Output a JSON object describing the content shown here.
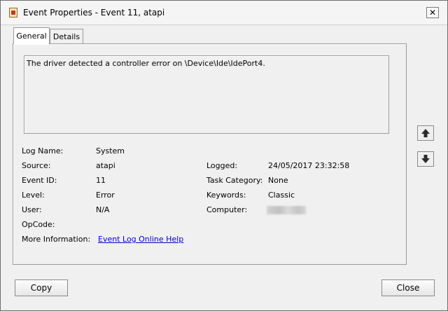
{
  "window": {
    "title": "Event Properties - Event 11, atapi",
    "close_glyph": "✕"
  },
  "tabs": [
    {
      "label": "General",
      "active": true
    },
    {
      "label": "Details",
      "active": false
    }
  ],
  "description": "The driver detected a controller error on \\Device\\Ide\\IdePort4.",
  "fields": {
    "log_name": {
      "label": "Log Name:",
      "value": "System"
    },
    "source": {
      "label": "Source:",
      "value": "atapi"
    },
    "event_id": {
      "label": "Event ID:",
      "value": "11"
    },
    "level": {
      "label": "Level:",
      "value": "Error"
    },
    "user": {
      "label": "User:",
      "value": "N/A"
    },
    "opcode": {
      "label": "OpCode:",
      "value": ""
    },
    "more_info": {
      "label": "More Information:",
      "value": "Event Log Online Help"
    },
    "logged": {
      "label": "Logged:",
      "value": "24/05/2017 23:32:58"
    },
    "task_category": {
      "label": "Task Category:",
      "value": "None"
    },
    "keywords": {
      "label": "Keywords:",
      "value": "Classic"
    },
    "computer": {
      "label": "Computer:",
      "value": ""
    }
  },
  "buttons": {
    "copy": "Copy",
    "close": "Close"
  },
  "icons": {
    "app": "event-viewer-icon",
    "up": "arrow-up-icon",
    "down": "arrow-down-icon"
  }
}
